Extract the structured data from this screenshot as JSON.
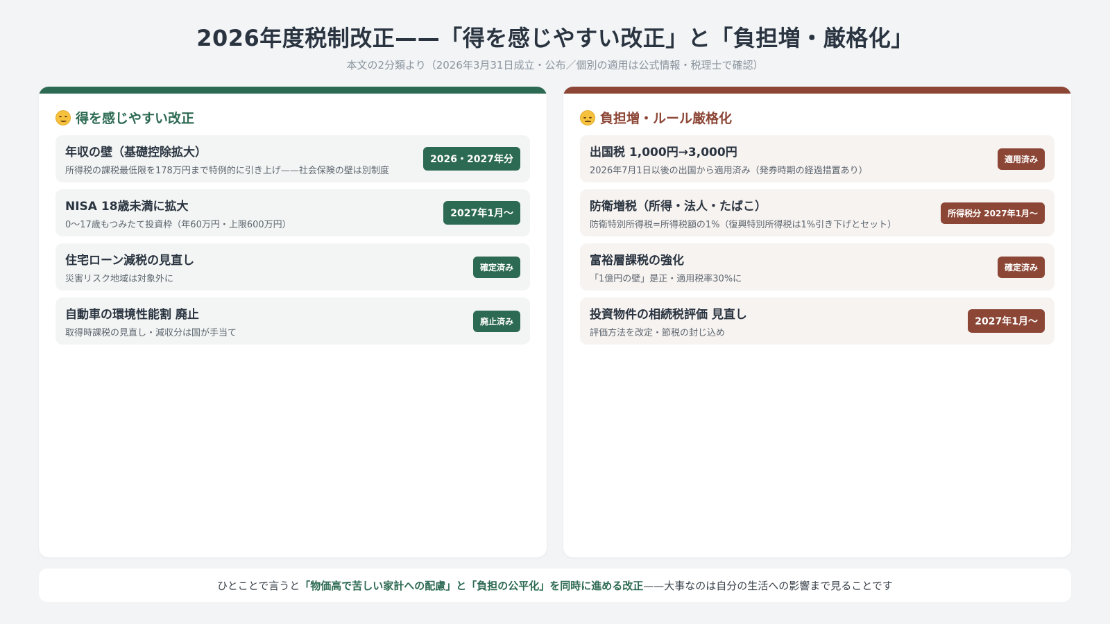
{
  "header": {
    "title": "2026年度税制改正——「得を感じやすい改正」と「負担増・厳格化」",
    "subtitle": "本文の2分類より（2026年3月31日成立・公布／個別の適用は公式情報・税理士で確認）"
  },
  "left_panel": {
    "icon": "smiling-face-icon",
    "heading": "得を感じやすい改正",
    "accent_color": "#2d6a53",
    "items": [
      {
        "title": "年収の壁（基礎控除拡大）",
        "desc": "所得税の課税最低限を178万円まで特例的に引き上げ——社会保険の壁は別制度",
        "badge": "2026・2027年分"
      },
      {
        "title": "NISA 18歳未満に拡大",
        "desc": "0〜17歳もつみたて投資枠（年60万円・上限600万円）",
        "badge": "2027年1月〜"
      },
      {
        "title": "住宅ローン減税の見直し",
        "desc": "災害リスク地域は対象外に",
        "badge": "確定済み"
      },
      {
        "title": "自動車の環境性能割 廃止",
        "desc": "取得時課税の見直し・減収分は国が手当て",
        "badge": "廃止済み"
      }
    ]
  },
  "right_panel": {
    "icon": "pensive-face-icon",
    "heading": "負担増・ルール厳格化",
    "accent_color": "#8c4636",
    "items": [
      {
        "title": "出国税 1,000円→3,000円",
        "desc": "2026年7月1日以後の出国から適用済み（発券時期の経過措置あり）",
        "badge": "適用済み"
      },
      {
        "title": "防衛増税（所得・法人・たばこ）",
        "desc": "防衛特別所得税=所得税額の1%（復興特別所得税は1%引き下げとセット）",
        "badge": "所得税分 2027年1月〜"
      },
      {
        "title": "富裕層課税の強化",
        "desc": "「1億円の壁」是正・適用税率30%に",
        "badge": "確定済み"
      },
      {
        "title": "投資物件の相続税評価 見直し",
        "desc": "評価方法を改定・節税の封じ込め",
        "badge": "2027年1月〜"
      }
    ]
  },
  "footer": {
    "prefix": "ひとことで言うと",
    "highlight": "「物価高で苦しい家計への配慮」と「負担の公平化」を同時に進める改正",
    "suffix": "——大事なのは自分の生活への影響まで見ることです"
  }
}
